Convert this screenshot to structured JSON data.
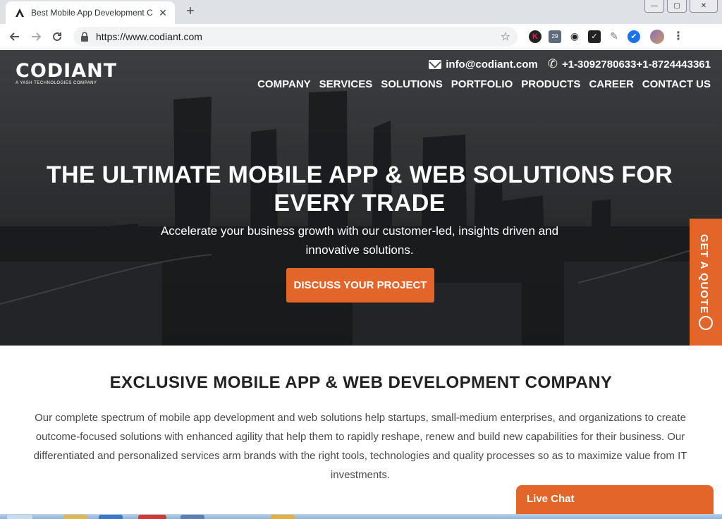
{
  "browser": {
    "tab_title": "Best Mobile App Development C",
    "url": "https://www.codiant.com",
    "window_controls": {
      "minimize": "—",
      "restore": "▢",
      "close": "✕"
    },
    "extensions": [
      {
        "name": "k-extension",
        "label": "K"
      },
      {
        "name": "calendar-extension",
        "label": "29"
      },
      {
        "name": "camera-extension",
        "label": "◉"
      },
      {
        "name": "checklist-extension",
        "label": "✓"
      },
      {
        "name": "brush-extension",
        "label": "✎"
      },
      {
        "name": "verified-extension",
        "label": "✔"
      }
    ]
  },
  "site": {
    "logo": {
      "wordmark": "CODIANT",
      "tagline": "A YASH TECHNOLOGIES COMPANY"
    },
    "contact": {
      "email": "info@codiant.com",
      "phone": "+1-3092780633+1-8724443361"
    },
    "nav": [
      "COMPANY",
      "SERVICES",
      "SOLUTIONS",
      "PORTFOLIO",
      "PRODUCTS",
      "CAREER",
      "CONTACT US"
    ],
    "hero": {
      "title": "THE ULTIMATE MOBILE APP & WEB SOLUTIONS FOR EVERY TRADE",
      "subtitle": "Accelerate your business growth with our customer-led, insights driven and innovative solutions.",
      "cta": "DISCUSS YOUR PROJECT"
    },
    "quote_tab": "GET A QUOTE",
    "section": {
      "title": "EXCLUSIVE MOBILE APP & WEB DEVELOPMENT COMPANY",
      "body": "Our complete spectrum of mobile app development and web solutions help startups, small-medium enterprises, and organizations to create outcome-focused solutions with enhanced agility that help them to rapidly reshape, renew and build new capabilities for their business. Our differentiated and personalized services arm brands with the right tools, technologies and quality processes so as to maximize value from IT investments."
    },
    "live_chat": "Live Chat"
  },
  "colors": {
    "accent": "#e2652a"
  }
}
